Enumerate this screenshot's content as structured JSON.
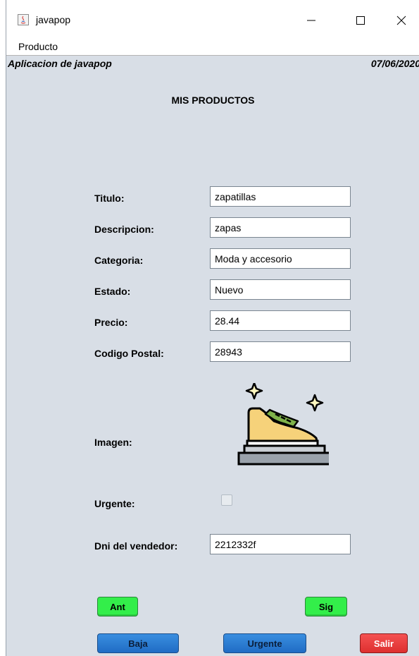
{
  "window": {
    "title": "javapop",
    "controls": {
      "minimize": "minimize-icon",
      "maximize": "maximize-icon",
      "close": "close-icon"
    }
  },
  "menu": {
    "items": [
      "Producto"
    ]
  },
  "header": {
    "left": "Aplicacion de javapop",
    "right": "07/06/2020"
  },
  "page_title": "MIS PRODUCTOS",
  "form": {
    "titulo": {
      "label": "Titulo:",
      "value": "zapatillas"
    },
    "descripcion": {
      "label": "Descripcion:",
      "value": "zapas"
    },
    "categoria": {
      "label": "Categoria:",
      "value": "Moda y accesorio"
    },
    "estado": {
      "label": "Estado:",
      "value": "Nuevo"
    },
    "precio": {
      "label": "Precio:",
      "value": "28.44"
    },
    "codigo_postal": {
      "label": "Codigo Postal:",
      "value": "28943"
    },
    "imagen": {
      "label": "Imagen:",
      "icon": "sneaker-icon"
    },
    "urgente": {
      "label": "Urgente:",
      "checked": false
    },
    "dni": {
      "label": "Dni del vendedor:",
      "value": "2212332f"
    }
  },
  "buttons": {
    "ant": "Ant",
    "sig": "Sig",
    "baja": "Baja",
    "urgente": "Urgente",
    "salir": "Salir"
  },
  "colors": {
    "background": "#d8dee6",
    "green_button": "#33ee4a",
    "blue_button": "#1f6cc4",
    "red_button": "#de2f2f"
  }
}
